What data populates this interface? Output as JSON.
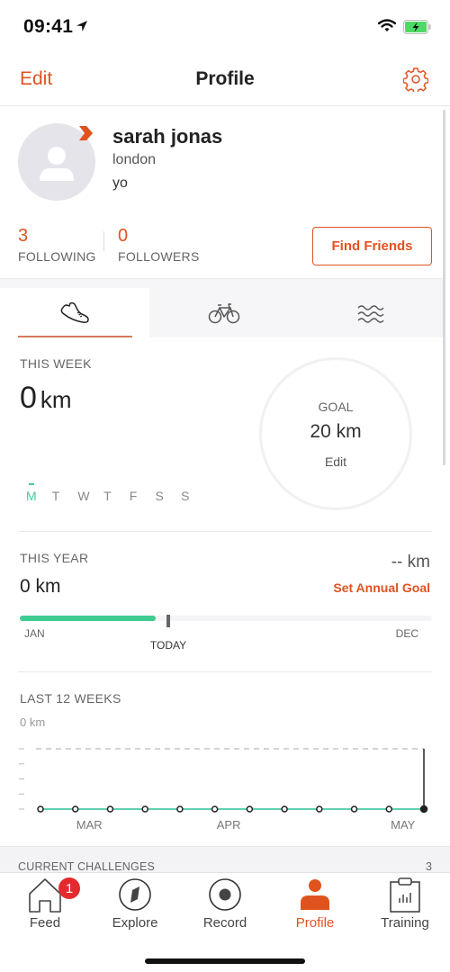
{
  "status_bar": {
    "time": "09:41",
    "icons": [
      "location-arrow-icon",
      "wifi-icon",
      "battery-charging-icon"
    ]
  },
  "nav": {
    "edit_label": "Edit",
    "title": "Profile",
    "settings_icon": "gear-icon"
  },
  "profile": {
    "name": "sarah jonas",
    "city": "london",
    "bio": "yo",
    "following_count": "3",
    "following_label": "FOLLOWING",
    "followers_count": "0",
    "followers_label": "FOLLOWERS",
    "find_friends_label": "Find Friends"
  },
  "sport_tabs": [
    {
      "icon": "running-shoe-icon",
      "active": true
    },
    {
      "icon": "bicycle-icon",
      "active": false
    },
    {
      "icon": "swim-waves-icon",
      "active": false
    }
  ],
  "this_week": {
    "label": "THIS WEEK",
    "value": "0",
    "unit": "km",
    "days": [
      "M",
      "T",
      "W",
      "T",
      "F",
      "S",
      "S"
    ],
    "today_index": 0,
    "goal_label": "GOAL",
    "goal_value": "20 km",
    "goal_edit": "Edit",
    "goal_progress": 0
  },
  "this_year": {
    "label": "THIS YEAR",
    "value": "0 km",
    "goal": "-- km",
    "set_goal_label": "Set Annual Goal",
    "progress_fraction": 0.33,
    "today_fraction": 0.36,
    "start_label": "JAN",
    "end_label": "DEC",
    "today_label": "TODAY"
  },
  "last_12_weeks": {
    "label": "LAST 12 WEEKS",
    "value": "0 km",
    "chart_data": {
      "type": "line",
      "series": [
        {
          "name": "distance_km",
          "values": [
            0,
            0,
            0,
            0,
            0,
            0,
            0,
            0,
            0,
            0,
            0,
            0
          ]
        }
      ],
      "x_labels": [
        {
          "index": 1.4,
          "label": "MAR"
        },
        {
          "index": 5.4,
          "label": "APR"
        },
        {
          "index": 10.4,
          "label": "MAY"
        }
      ],
      "ylim": [
        0,
        4
      ],
      "highlight_index": 11
    }
  },
  "challenges": {
    "label": "CURRENT CHALLENGES",
    "count": "3"
  },
  "tabbar": {
    "items": [
      {
        "label": "Feed",
        "icon": "home-icon",
        "badge": "1",
        "active": false
      },
      {
        "label": "Explore",
        "icon": "compass-icon",
        "active": false
      },
      {
        "label": "Record",
        "icon": "record-icon",
        "active": false
      },
      {
        "label": "Profile",
        "icon": "person-icon",
        "active": true
      },
      {
        "label": "Training",
        "icon": "clipboard-chart-icon",
        "active": false
      }
    ]
  },
  "colors": {
    "accent": "#e0531f",
    "green": "#3ecb92",
    "teal_line": "#5fd0b0",
    "badge_red": "#e42a2f"
  }
}
